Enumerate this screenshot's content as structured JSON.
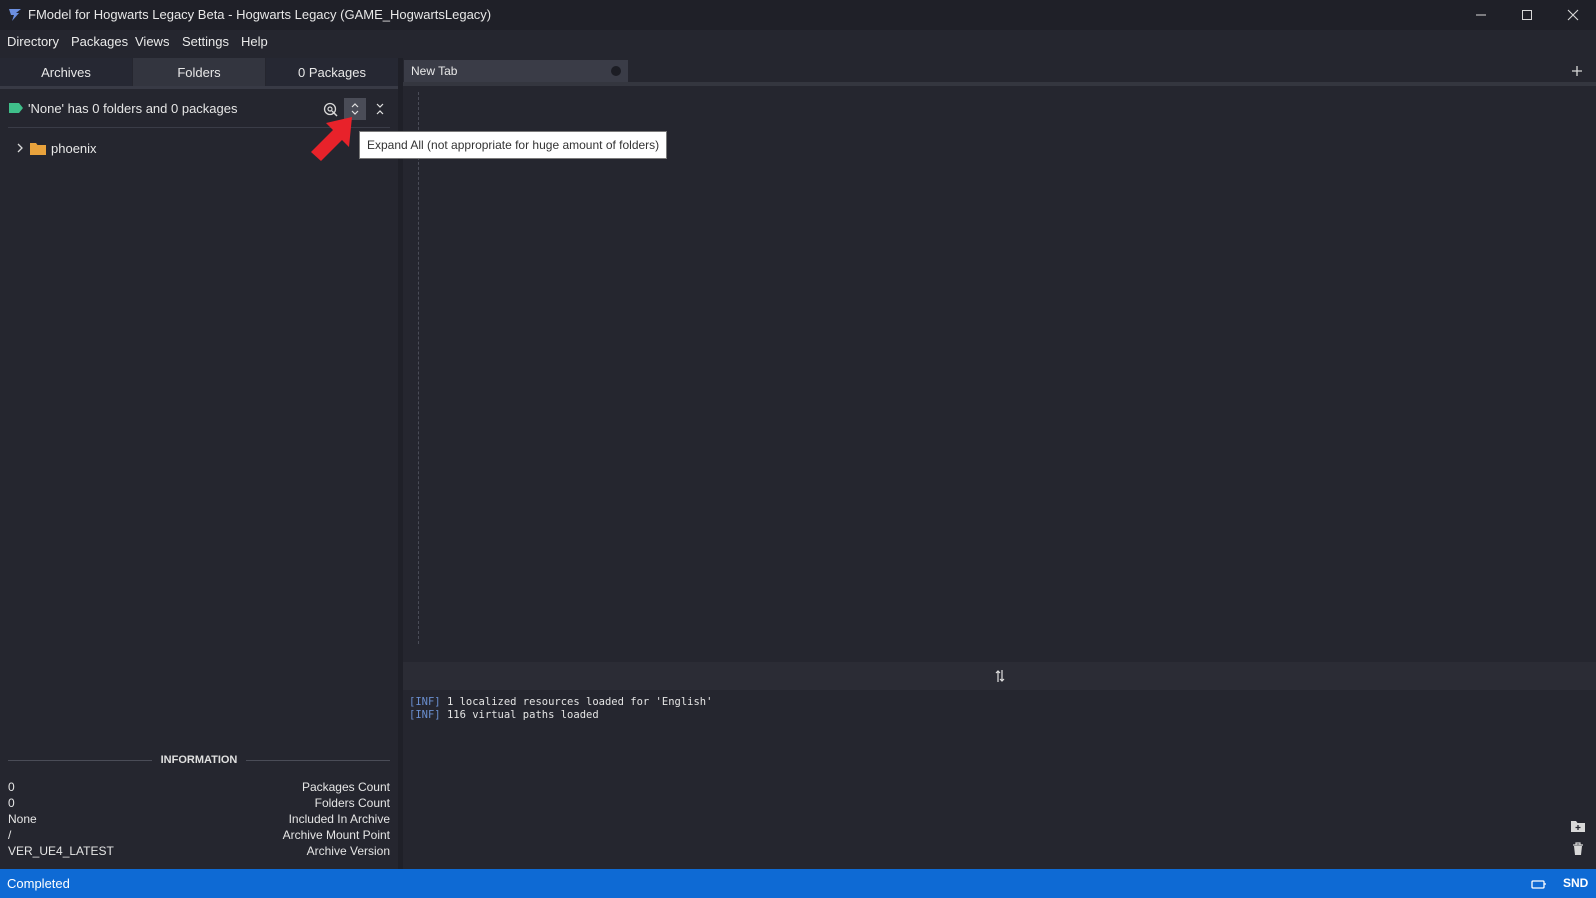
{
  "window": {
    "title": "FModel for Hogwarts Legacy Beta - Hogwarts Legacy (GAME_HogwartsLegacy)"
  },
  "menu": [
    "Directory",
    "Packages",
    "Views",
    "Settings",
    "Help"
  ],
  "left_tabs": [
    {
      "label": "Archives",
      "active": false
    },
    {
      "label": "Folders",
      "active": true
    },
    {
      "label": "0 Packages",
      "active": false
    }
  ],
  "folder_hint": "'None' has 0 folders and 0 packages",
  "tree": [
    {
      "label": "phoenix",
      "expanded": false
    }
  ],
  "tooltip": "Expand All (not appropriate for huge amount of folders)",
  "information": {
    "title": "INFORMATION",
    "rows": [
      {
        "value": "0",
        "label": "Packages Count"
      },
      {
        "value": "0",
        "label": "Folders Count"
      },
      {
        "value": "None",
        "label": "Included In Archive"
      },
      {
        "value": "/",
        "label": "Archive Mount Point"
      },
      {
        "value": "VER_UE4_LATEST",
        "label": "Archive Version"
      }
    ]
  },
  "document_tab": {
    "label": "New Tab"
  },
  "log": [
    {
      "tag": "[INF]",
      "text": "1 localized resources loaded for 'English'"
    },
    {
      "tag": "[INF]",
      "text": "116 virtual paths loaded"
    }
  ],
  "status": {
    "text": "Completed",
    "right_label": "SND"
  },
  "colors": {
    "accent": "#0e6ad4",
    "folder": "#e8a23c",
    "tag_icon": "#3fbf8a",
    "arrow": "#e8222a"
  }
}
